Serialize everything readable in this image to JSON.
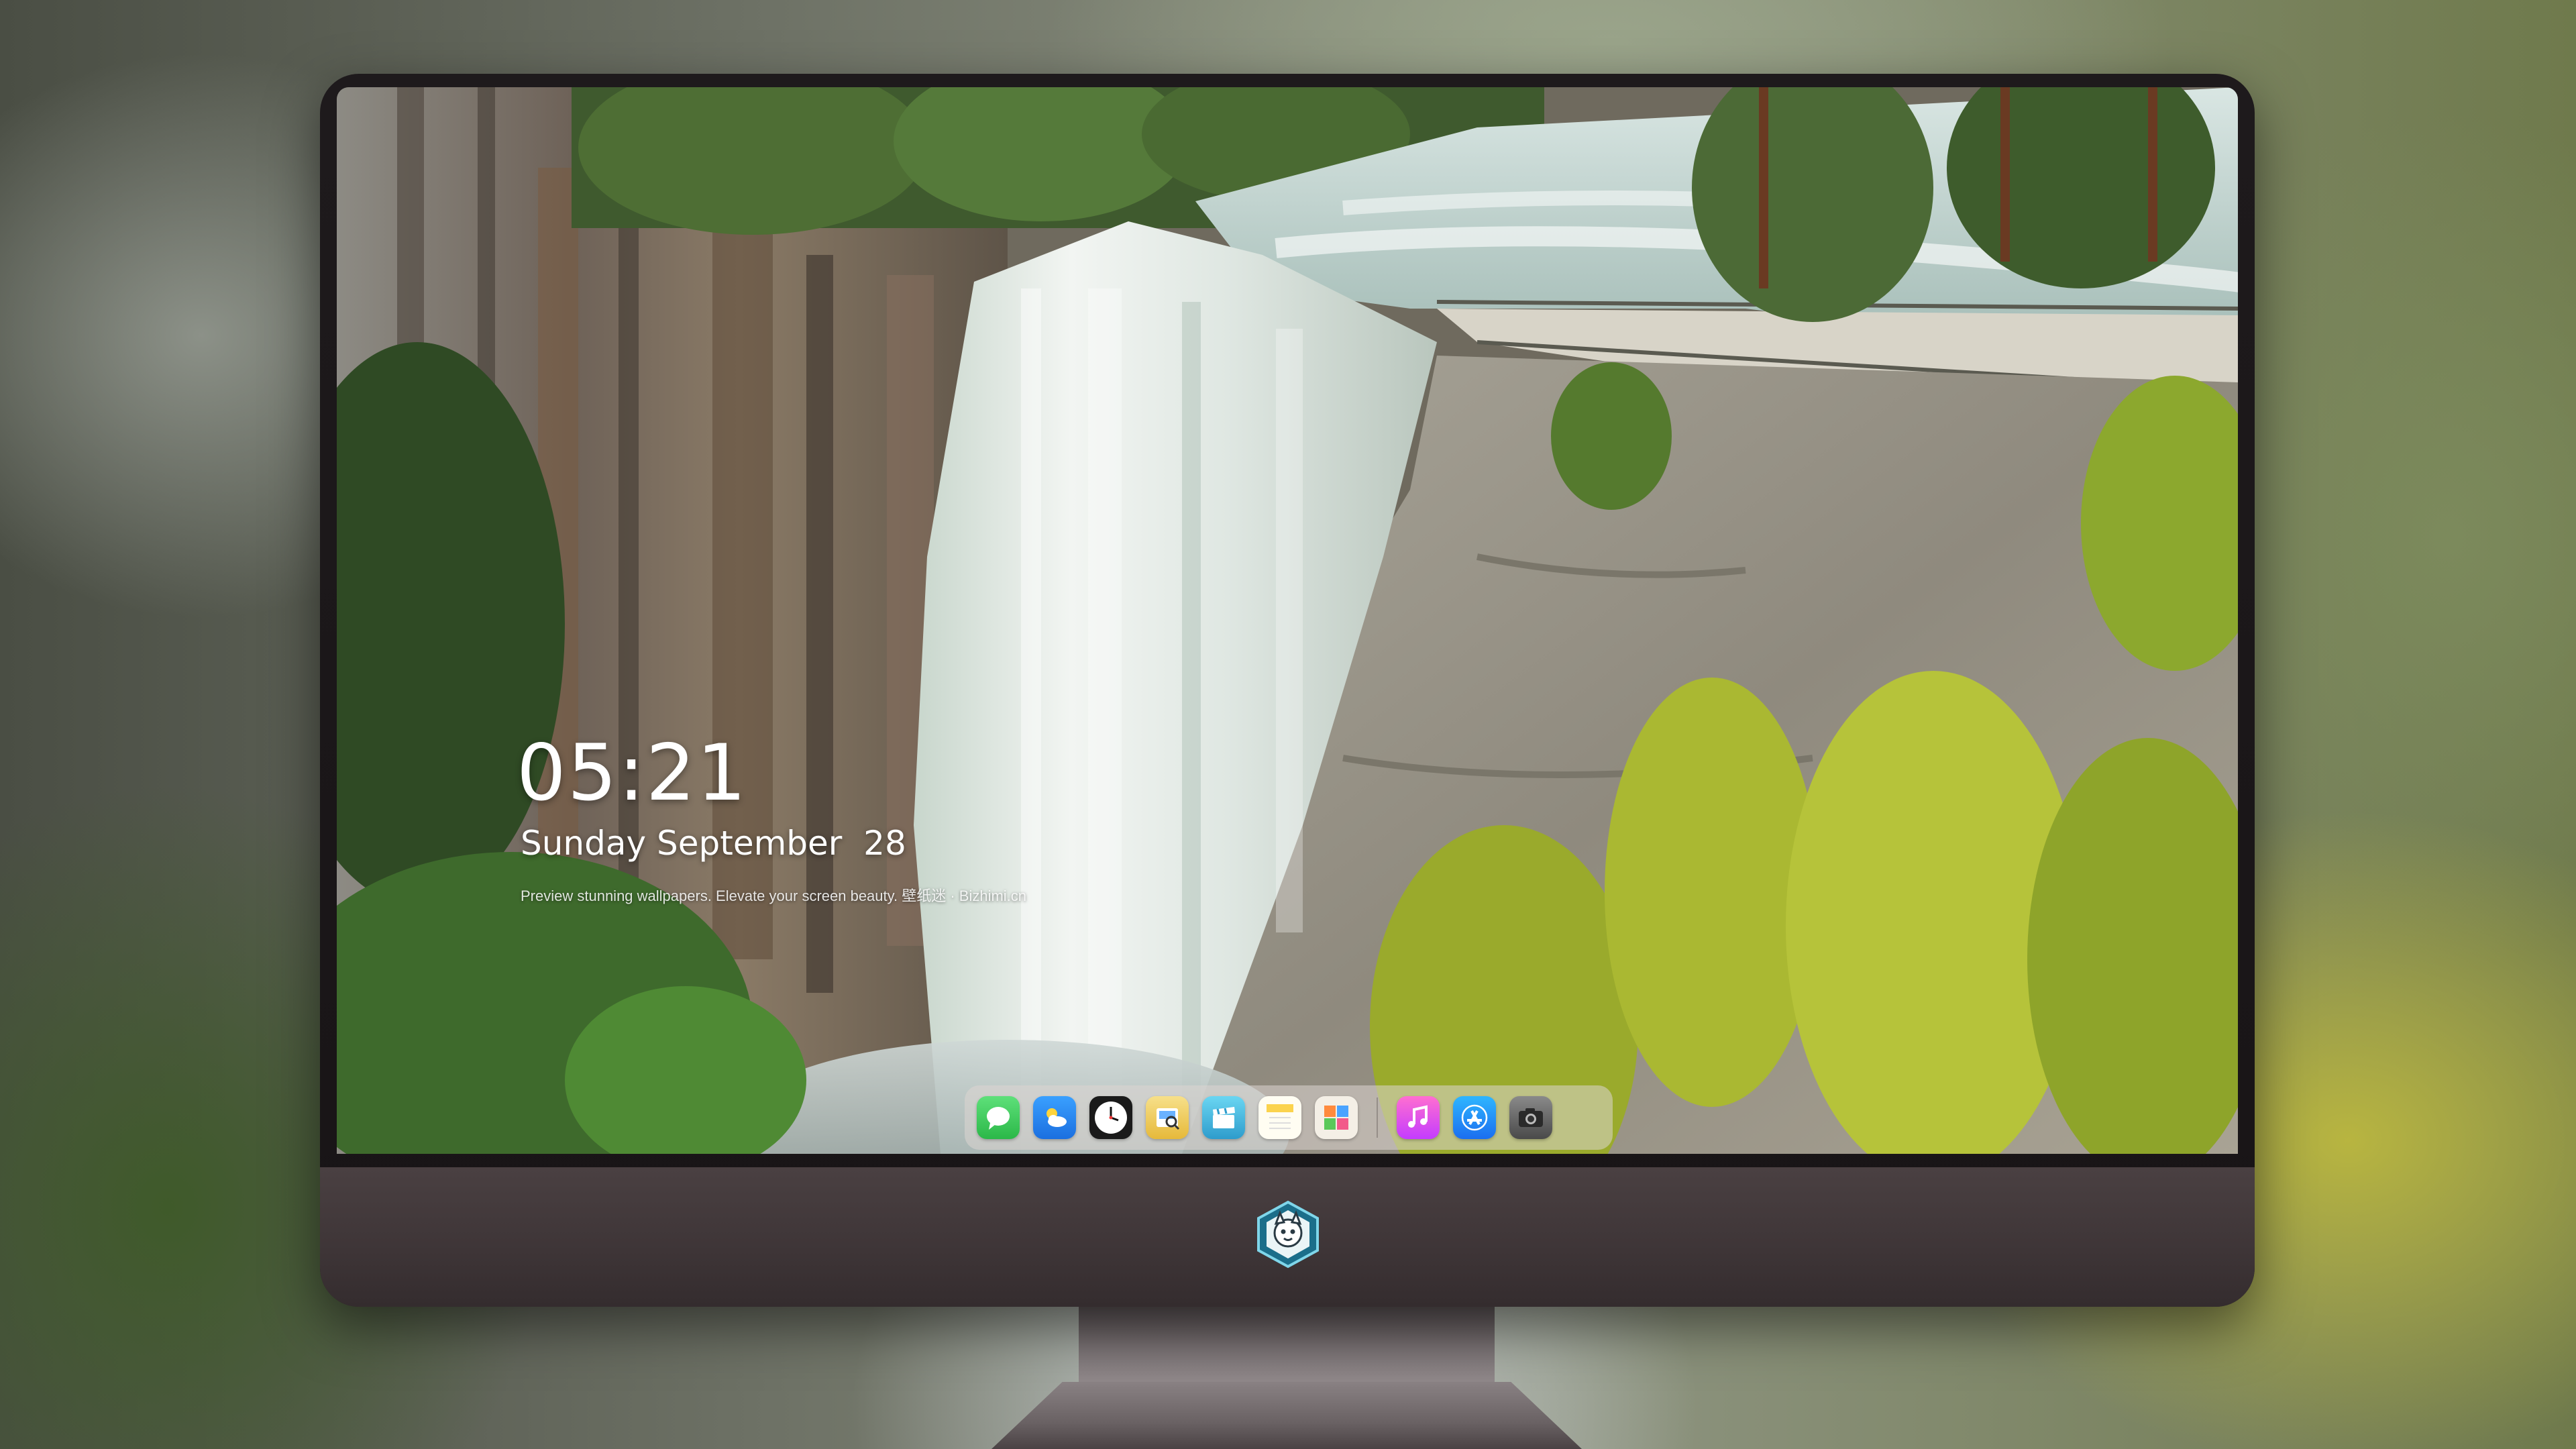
{
  "lockscreen": {
    "time": "05:21",
    "date": "Sunday September  28",
    "tagline": "Preview stunning wallpapers. Elevate your screen beauty. 壁纸迷 · Bizhimi.cn"
  },
  "dock": {
    "apps": [
      {
        "icon": "messages-icon",
        "color": "#34c759"
      },
      {
        "icon": "weather-icon",
        "color": "#2f8cf0"
      },
      {
        "icon": "clock-icon",
        "color": "#ffffff"
      },
      {
        "icon": "preview-icon",
        "color": "#f2c94c"
      },
      {
        "icon": "clips-icon",
        "color": "#4cc1e6"
      },
      {
        "icon": "notes-icon",
        "color": "#fbd34d"
      },
      {
        "icon": "photo-booth-icon",
        "color": "#e9e2d8"
      },
      {
        "icon": "music-icon",
        "color": "#f24cc0"
      },
      {
        "icon": "app-store-icon",
        "color": "#1e90ff"
      },
      {
        "icon": "camera-icon",
        "color": "#6b6b6b"
      }
    ]
  },
  "colors": {
    "bezel": "#1c181a",
    "chin": "#3e3537",
    "dock_bg": "#dcd6d2"
  }
}
